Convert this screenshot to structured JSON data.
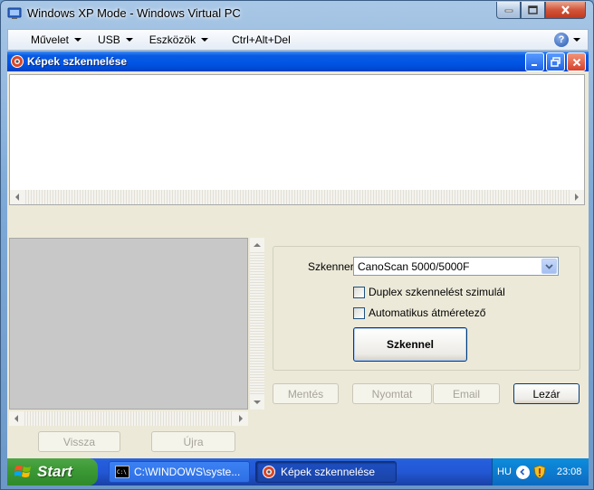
{
  "host_window": {
    "title": "Windows XP Mode - Windows Virtual PC",
    "menu": [
      {
        "label": "Művelet",
        "has_dropdown": true
      },
      {
        "label": "USB",
        "has_dropdown": true
      },
      {
        "label": "Eszközök",
        "has_dropdown": true
      },
      {
        "label": "Ctrl+Alt+Del",
        "has_dropdown": false
      }
    ],
    "help_icon": "?"
  },
  "app_window": {
    "title": "Képek szkennelése",
    "scanner_label": "Szkenner:",
    "scanner_selected": "CanoScan 5000/5000F",
    "checkbox_duplex": {
      "label": "Duplex szkennelést szimulál",
      "checked": false
    },
    "checkbox_resize": {
      "label": "Automatikus átméretező",
      "checked": false
    },
    "scan_button": "Szkennel",
    "save_button": "Mentés",
    "print_button": "Nyomtat",
    "email_button": "Email",
    "close_button": "Lezár",
    "back_button": "Vissza",
    "again_button": "Újra"
  },
  "taskbar": {
    "start_label": "Start",
    "tasks": [
      {
        "label": "C:\\WINDOWS\\syste...",
        "icon": "cmd-icon",
        "active": false
      },
      {
        "label": "Képek szkennelése",
        "icon": "scanner-app-icon",
        "active": true
      }
    ],
    "language": "HU",
    "clock": "23:08"
  },
  "colors": {
    "xp_title_blue": "#0055e5",
    "taskbar_blue": "#245edc",
    "start_green": "#3c9a35",
    "tray_blue": "#0c7cd0",
    "dialog_bg": "#ece9d8"
  }
}
